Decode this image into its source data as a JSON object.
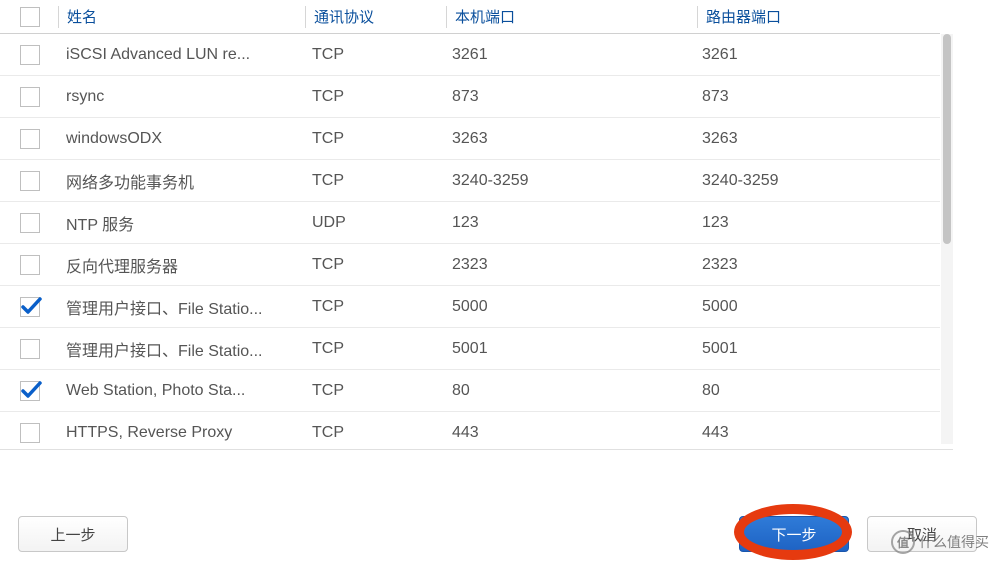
{
  "columns": {
    "name": "姓名",
    "protocol": "通讯协议",
    "local_port": "本机端口",
    "router_port": "路由器端口"
  },
  "rows": [
    {
      "checked": false,
      "name": "iSCSI Advanced LUN re...",
      "protocol": "TCP",
      "local_port": "3261",
      "router_port": "3261"
    },
    {
      "checked": false,
      "name": "rsync",
      "protocol": "TCP",
      "local_port": "873",
      "router_port": "873"
    },
    {
      "checked": false,
      "name": "windowsODX",
      "protocol": "TCP",
      "local_port": "3263",
      "router_port": "3263"
    },
    {
      "checked": false,
      "name": "网络多功能事务机",
      "protocol": "TCP",
      "local_port": "3240-3259",
      "router_port": "3240-3259"
    },
    {
      "checked": false,
      "name": "NTP 服务",
      "protocol": "UDP",
      "local_port": "123",
      "router_port": "123"
    },
    {
      "checked": false,
      "name": "反向代理服务器",
      "protocol": "TCP",
      "local_port": "2323",
      "router_port": "2323"
    },
    {
      "checked": true,
      "name": "管理用户接口、File Statio...",
      "protocol": "TCP",
      "local_port": "5000",
      "router_port": "5000"
    },
    {
      "checked": false,
      "name": "管理用户接口、File Statio...",
      "protocol": "TCP",
      "local_port": "5001",
      "router_port": "5001"
    },
    {
      "checked": true,
      "name": "Web Station, Photo Sta...",
      "protocol": "TCP",
      "local_port": "80",
      "router_port": "80"
    },
    {
      "checked": false,
      "name": "HTTPS, Reverse Proxy",
      "protocol": "TCP",
      "local_port": "443",
      "router_port": "443"
    }
  ],
  "buttons": {
    "prev": "上一步",
    "next": "下一步",
    "cancel": "取消"
  },
  "watermark": {
    "badge": "值",
    "text": "什么值得买"
  }
}
